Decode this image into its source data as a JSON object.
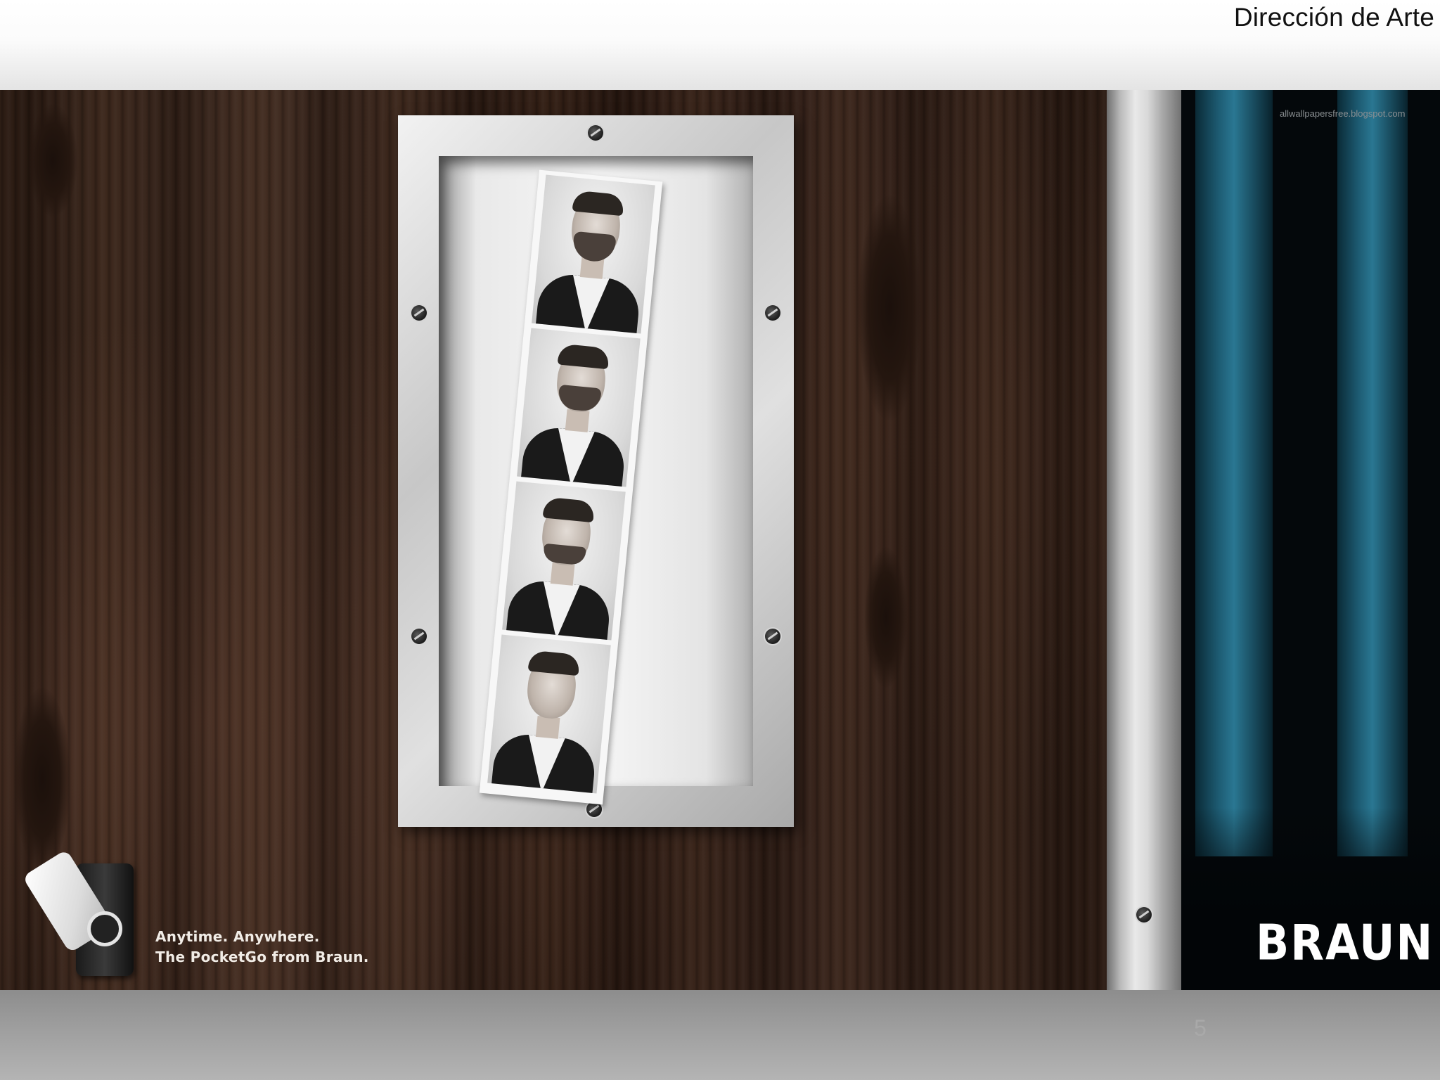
{
  "slide": {
    "title": "Dirección de Arte",
    "page_number": "5"
  },
  "ad": {
    "watermark": "allwallpapersfree.blogspot.com",
    "tagline_line1": "Anytime. Anywhere.",
    "tagline_line2": "The PocketGo from Braun.",
    "brand": "BRAUN"
  },
  "colors": {
    "wood": "#35221a",
    "curtain": "#1d5b72",
    "frame_metal": "#c7c7c7"
  }
}
